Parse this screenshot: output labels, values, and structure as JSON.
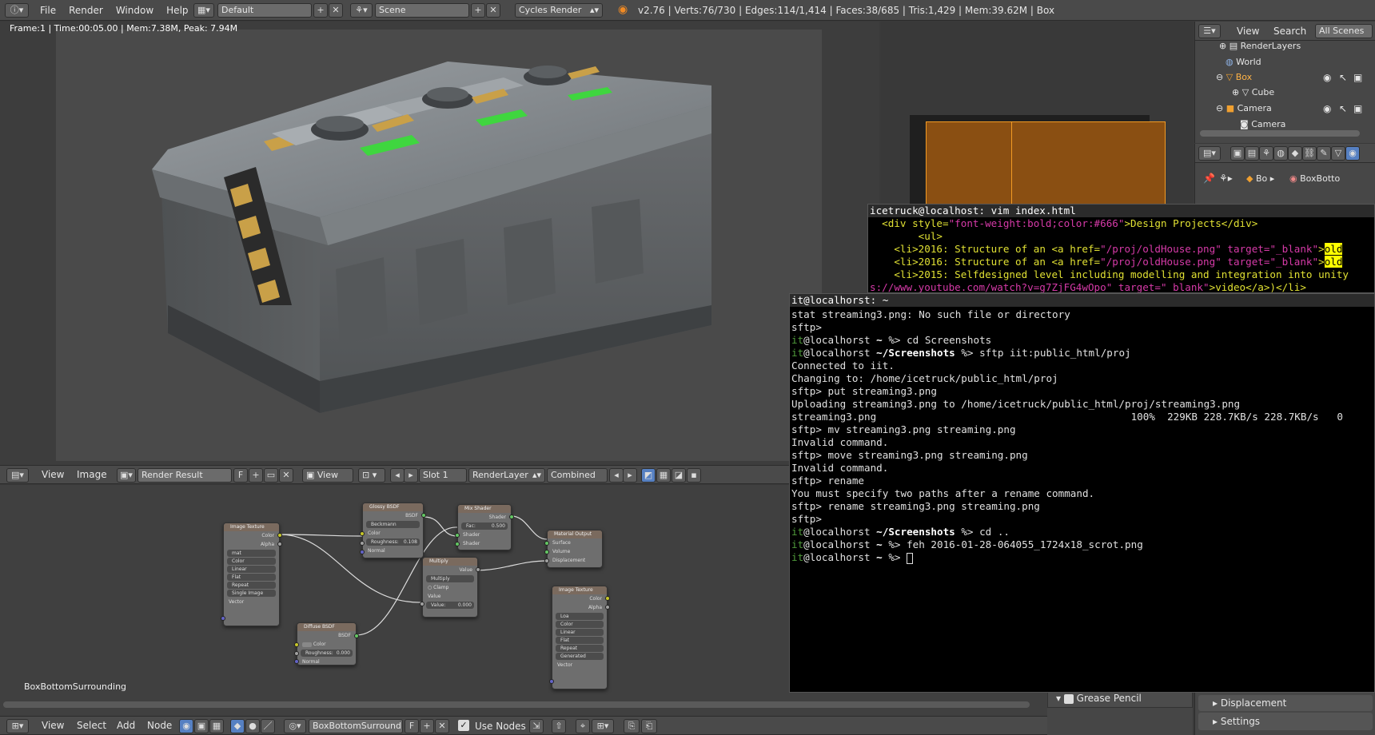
{
  "top_bar": {
    "menus": [
      "File",
      "Render",
      "Window",
      "Help"
    ],
    "layout": "Default",
    "scene": "Scene",
    "engine": "Cycles Render",
    "stats": "v2.76 | Verts:76/730 | Edges:114/1,414 | Faces:38/685 | Tris:1,429 | Mem:39.62M | Box"
  },
  "render_view": {
    "info": "Frame:1 | Time:00:05.00 | Mem:7.38M, Peak: 7.94M"
  },
  "image_header": {
    "view": "View",
    "image": "Image",
    "image_name": "Render Result",
    "fake_user": "F",
    "view2": "View",
    "slot": "Slot 1",
    "layer": "RenderLayer",
    "pass": "Combined"
  },
  "node_editor": {
    "material_label": "BoxBottomSurrounding",
    "nodes": {
      "img1": {
        "title": "Image Texture",
        "out_color": "Color",
        "out_alpha": "Alpha",
        "file": "mat",
        "opt1": "Color",
        "opt2": "Linear",
        "opt3": "Flat",
        "opt4": "Repeat",
        "opt5": "Single Image",
        "in_vector": "Vector"
      },
      "glossy": {
        "title": "Glossy BSDF",
        "out": "BSDF",
        "dist": "Beckmann",
        "in_color": "Color",
        "rough": "Roughness:",
        "rough_v": "0.108",
        "normal": "Normal"
      },
      "mix": {
        "title": "Mix Shader",
        "out": "Shader",
        "fac": "Fac:",
        "fac_v": "0.500",
        "in1": "Shader",
        "in2": "Shader"
      },
      "output": {
        "title": "Material Output",
        "surface": "Surface",
        "volume": "Volume",
        "disp": "Displacement"
      },
      "multiply": {
        "title": "Multiply",
        "out": "Value",
        "op": "Multiply",
        "clamp": "Clamp",
        "in": "Value",
        "val": "Value:",
        "val_v": "0.000"
      },
      "diffuse": {
        "title": "Diffuse BSDF",
        "out": "BSDF",
        "color": "Color",
        "rough": "Roughness:",
        "rough_v": "0.000",
        "normal": "Normal"
      },
      "img2": {
        "title": "Image Texture",
        "out_color": "Color",
        "out_alpha": "Alpha",
        "file": "Loa",
        "opt1": "Color",
        "opt2": "Linear",
        "opt3": "Flat",
        "opt4": "Repeat",
        "opt5": "Generated",
        "in_vector": "Vector"
      }
    }
  },
  "node_header": {
    "menus": [
      "View",
      "Select",
      "Add",
      "Node"
    ],
    "material": "BoxBottomSurround...",
    "fake_user": "F",
    "use_nodes": "Use Nodes"
  },
  "outliner": {
    "view": "View",
    "search": "Search",
    "scope": "All Scenes",
    "items": [
      "RenderLayers",
      "World",
      "Box",
      "Cube",
      "Camera",
      "Camera"
    ]
  },
  "properties": {
    "crumb1": "Bo",
    "crumb2": "BoxBotto",
    "grease": "Grease Pencil",
    "displacement": "Displacement",
    "settings": "Settings"
  },
  "vim_term": {
    "title": "icetruck@localhost: vim index.html",
    "lines": [
      {
        "i": "  ",
        "t1": "<div style=",
        "s": "\"font-weight:bold;color:#666\"",
        "t2": ">Design Projects</div>"
      },
      {
        "i": "        ",
        "t1": "<ul>",
        "s": "",
        "t2": ""
      },
      {
        "i": "    ",
        "t1": "<li>2016: Structure of an <a href=",
        "s": "\"/proj/oldHouse.png\" target=\"_blank\"",
        "t2": ">",
        "hl": "old"
      },
      {
        "i": "    ",
        "t1": "<li>2016: Structure of an <a href=",
        "s": "\"/proj/oldHouse.png\" target=\"_blank\"",
        "t2": ">",
        "hl": "old"
      },
      {
        "i": "    ",
        "t1": "<li>2015: Selfdesigned level including modelling and integration into unity",
        "s": "",
        "t2": ""
      },
      {
        "i": "",
        "t1": "",
        "s": "s://www.youtube.com/watch?v=g7ZjFG4wOpo\" target=\"_blank\"",
        "t2": ">video</a>)</li>"
      }
    ]
  },
  "shell_term": {
    "title": "it@localhorst: ~",
    "lines": [
      {
        "type": "out",
        "text": "stat streaming3.png: No such file or directory"
      },
      {
        "type": "out",
        "text": "sftp>"
      },
      {
        "type": "prompt",
        "user": "it",
        "host": "@localhorst",
        "dir": " ~ ",
        "end": "%>",
        "cmd": " cd Screenshots"
      },
      {
        "type": "prompt",
        "user": "it",
        "host": "@localhorst",
        "dir": " ~/Screenshots ",
        "end": "%>",
        "cmd": " sftp iit:public_html/proj"
      },
      {
        "type": "out",
        "text": "Connected to iit."
      },
      {
        "type": "out",
        "text": "Changing to: /home/icetruck/public_html/proj"
      },
      {
        "type": "out",
        "text": "sftp> put streaming3.png"
      },
      {
        "type": "out",
        "text": "Uploading streaming3.png to /home/icetruck/public_html/proj/streaming3.png"
      },
      {
        "type": "out",
        "text": "streaming3.png                                          100%  229KB 228.7KB/s 228.7KB/s   0"
      },
      {
        "type": "out",
        "text": "sftp> mv streaming3.png streaming.png"
      },
      {
        "type": "out",
        "text": "Invalid command."
      },
      {
        "type": "out",
        "text": "sftp> move streaming3.png streaming.png"
      },
      {
        "type": "out",
        "text": "Invalid command."
      },
      {
        "type": "out",
        "text": "sftp> rename"
      },
      {
        "type": "out",
        "text": "You must specify two paths after a rename command."
      },
      {
        "type": "out",
        "text": "sftp> rename streaming3.png streaming.png"
      },
      {
        "type": "out",
        "text": "sftp>"
      },
      {
        "type": "prompt",
        "user": "it",
        "host": "@localhorst",
        "dir": " ~/Screenshots ",
        "end": "%>",
        "cmd": " cd .."
      },
      {
        "type": "prompt",
        "user": "it",
        "host": "@localhorst",
        "dir": " ~ ",
        "end": "%>",
        "cmd": " feh 2016-01-28-064055_1724x18_scrot.png"
      },
      {
        "type": "prompt",
        "user": "it",
        "host": "@localhorst",
        "dir": " ~ ",
        "end": "%>",
        "cmd": " ",
        "cursor": true
      }
    ]
  },
  "colors": {
    "accent": "#5680c2",
    "term_user": "#4f9a3a",
    "vim_string": "#d63aa8",
    "vim_tag": "#e0e033",
    "highlight": "#ffff00",
    "node_header": "#7a6a5e"
  }
}
